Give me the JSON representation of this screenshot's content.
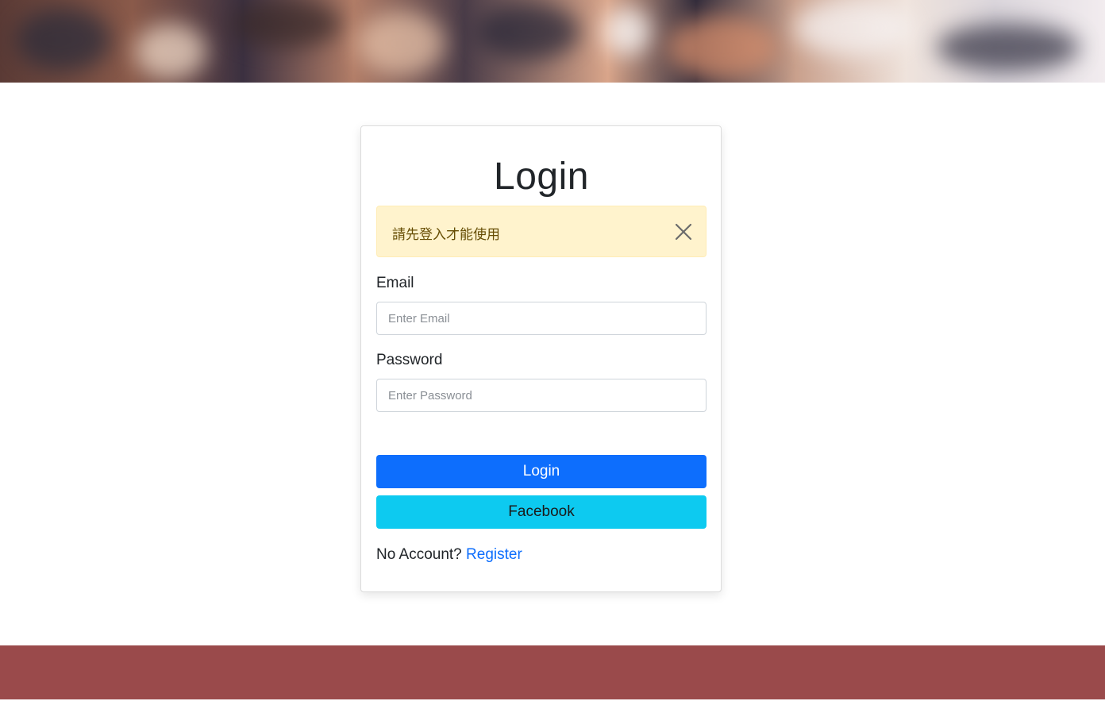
{
  "login_card": {
    "title": "Login",
    "alert": {
      "message": "請先登入才能使用",
      "close_icon": "close-icon"
    },
    "email": {
      "label": "Email",
      "placeholder": "Enter Email",
      "value": ""
    },
    "password": {
      "label": "Password",
      "placeholder": "Enter Password",
      "value": ""
    },
    "login_button": "Login",
    "facebook_button": "Facebook",
    "no_account_text": "No Account?",
    "register_link": "Register"
  },
  "colors": {
    "primary": "#0d6efd",
    "info": "#0dcaf0",
    "alert_bg": "#fff3cd",
    "footer": "#9a4a4b"
  }
}
